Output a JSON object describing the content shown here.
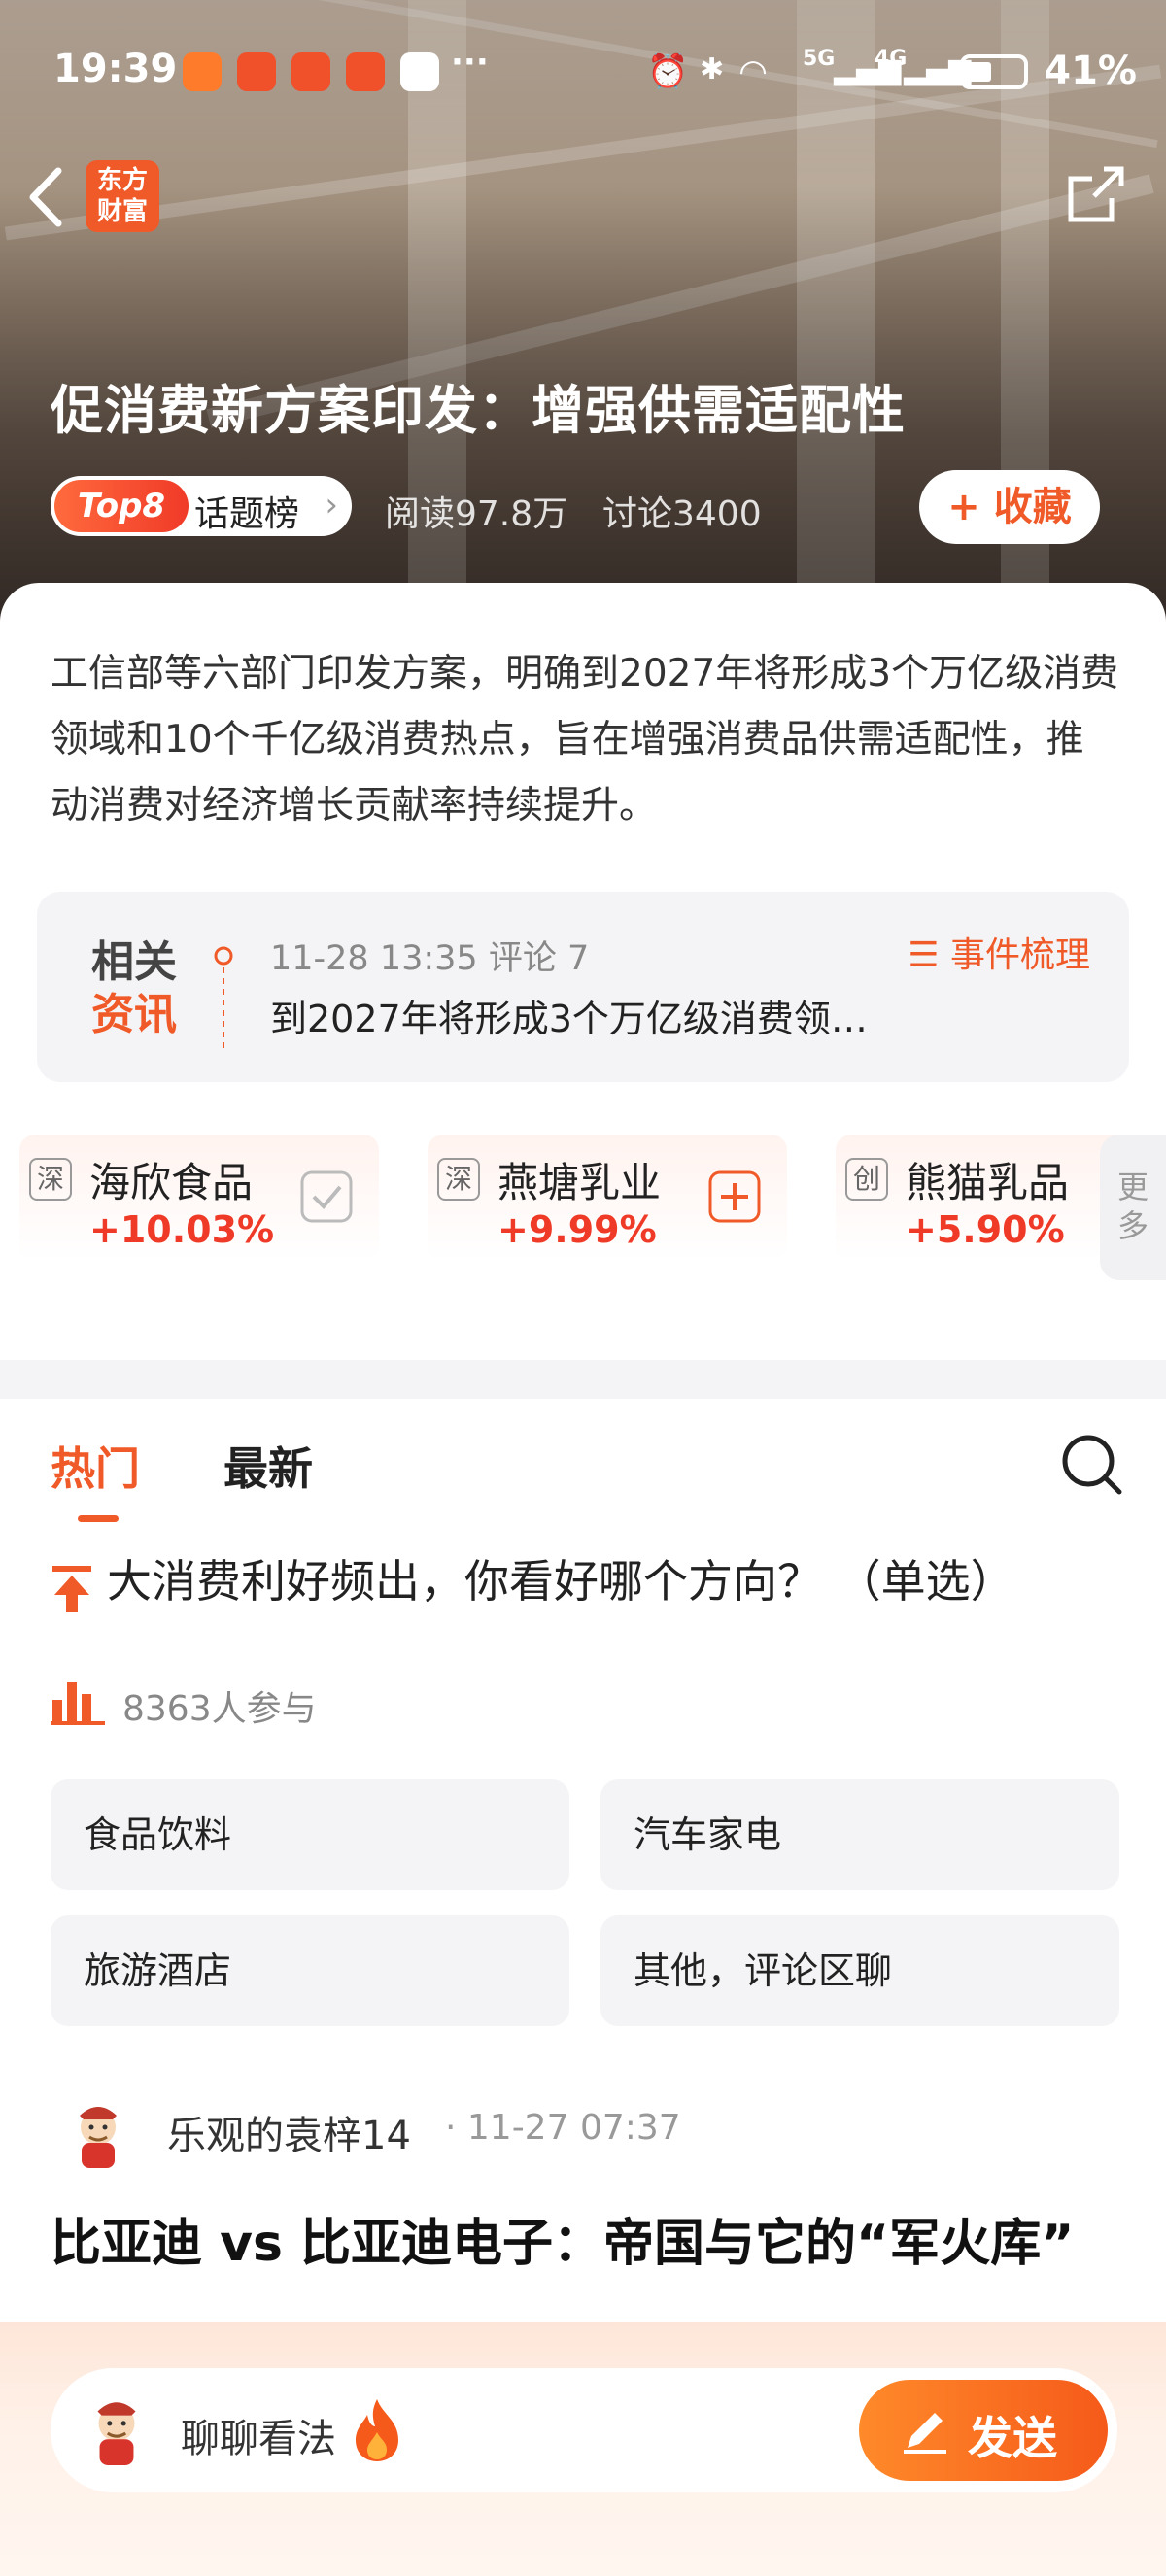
{
  "status_bar": {
    "time": "19:39",
    "battery": "41%",
    "signal_1": "5G",
    "signal_2": "4G",
    "more": "···"
  },
  "header": {
    "brand_line1": "东方",
    "brand_line2": "财富",
    "title": "促消费新方案印发：增强供需适配性",
    "rank_badge": "Top8",
    "rank_label": "话题榜",
    "reads": "阅读97.8万",
    "discussions": "讨论3400",
    "favorite_label": "+ 收藏"
  },
  "summary": "工信部等六部门印发方案，明确到2027年将形成3个万亿级消费领域和10个千亿级消费热点，旨在增强消费品供需适配性，推动消费对经济增长贡献率持续提升。",
  "related": {
    "badge_line1": "相关",
    "badge_line2": "资讯",
    "meta": "11-28 13:35 评论 7",
    "headline": "到2027年将形成3个万亿级消费领…",
    "events_label": "☰ 事件梳理"
  },
  "stocks": [
    {
      "market": "深",
      "name": "海欣食品",
      "change": "+10.03%",
      "action": "added"
    },
    {
      "market": "深",
      "name": "燕塘乳业",
      "change": "+9.99%",
      "action": "add"
    },
    {
      "market": "创",
      "name": "熊猫乳品",
      "change": "+5.90%",
      "action": "none"
    }
  ],
  "more_tab": "更多",
  "feed": {
    "tabs": [
      "热门",
      "最新"
    ],
    "poll": {
      "title": "大消费利好频出，你看好哪个方向？ （单选）",
      "participants": "8363人参与",
      "options": [
        "食品饮料",
        "汽车家电",
        "旅游酒店",
        "其他，评论区聊"
      ]
    },
    "post": {
      "author": "乐观的袁梓14",
      "time": "· 11-27 07:37",
      "title": "比亚迪 vs 比亚迪电子：帝国与它的“军火库”"
    }
  },
  "composer": {
    "placeholder": "聊聊看法",
    "send_label": "发送"
  },
  "colors": {
    "accent": "#f05a28",
    "rise": "#f03a28"
  }
}
